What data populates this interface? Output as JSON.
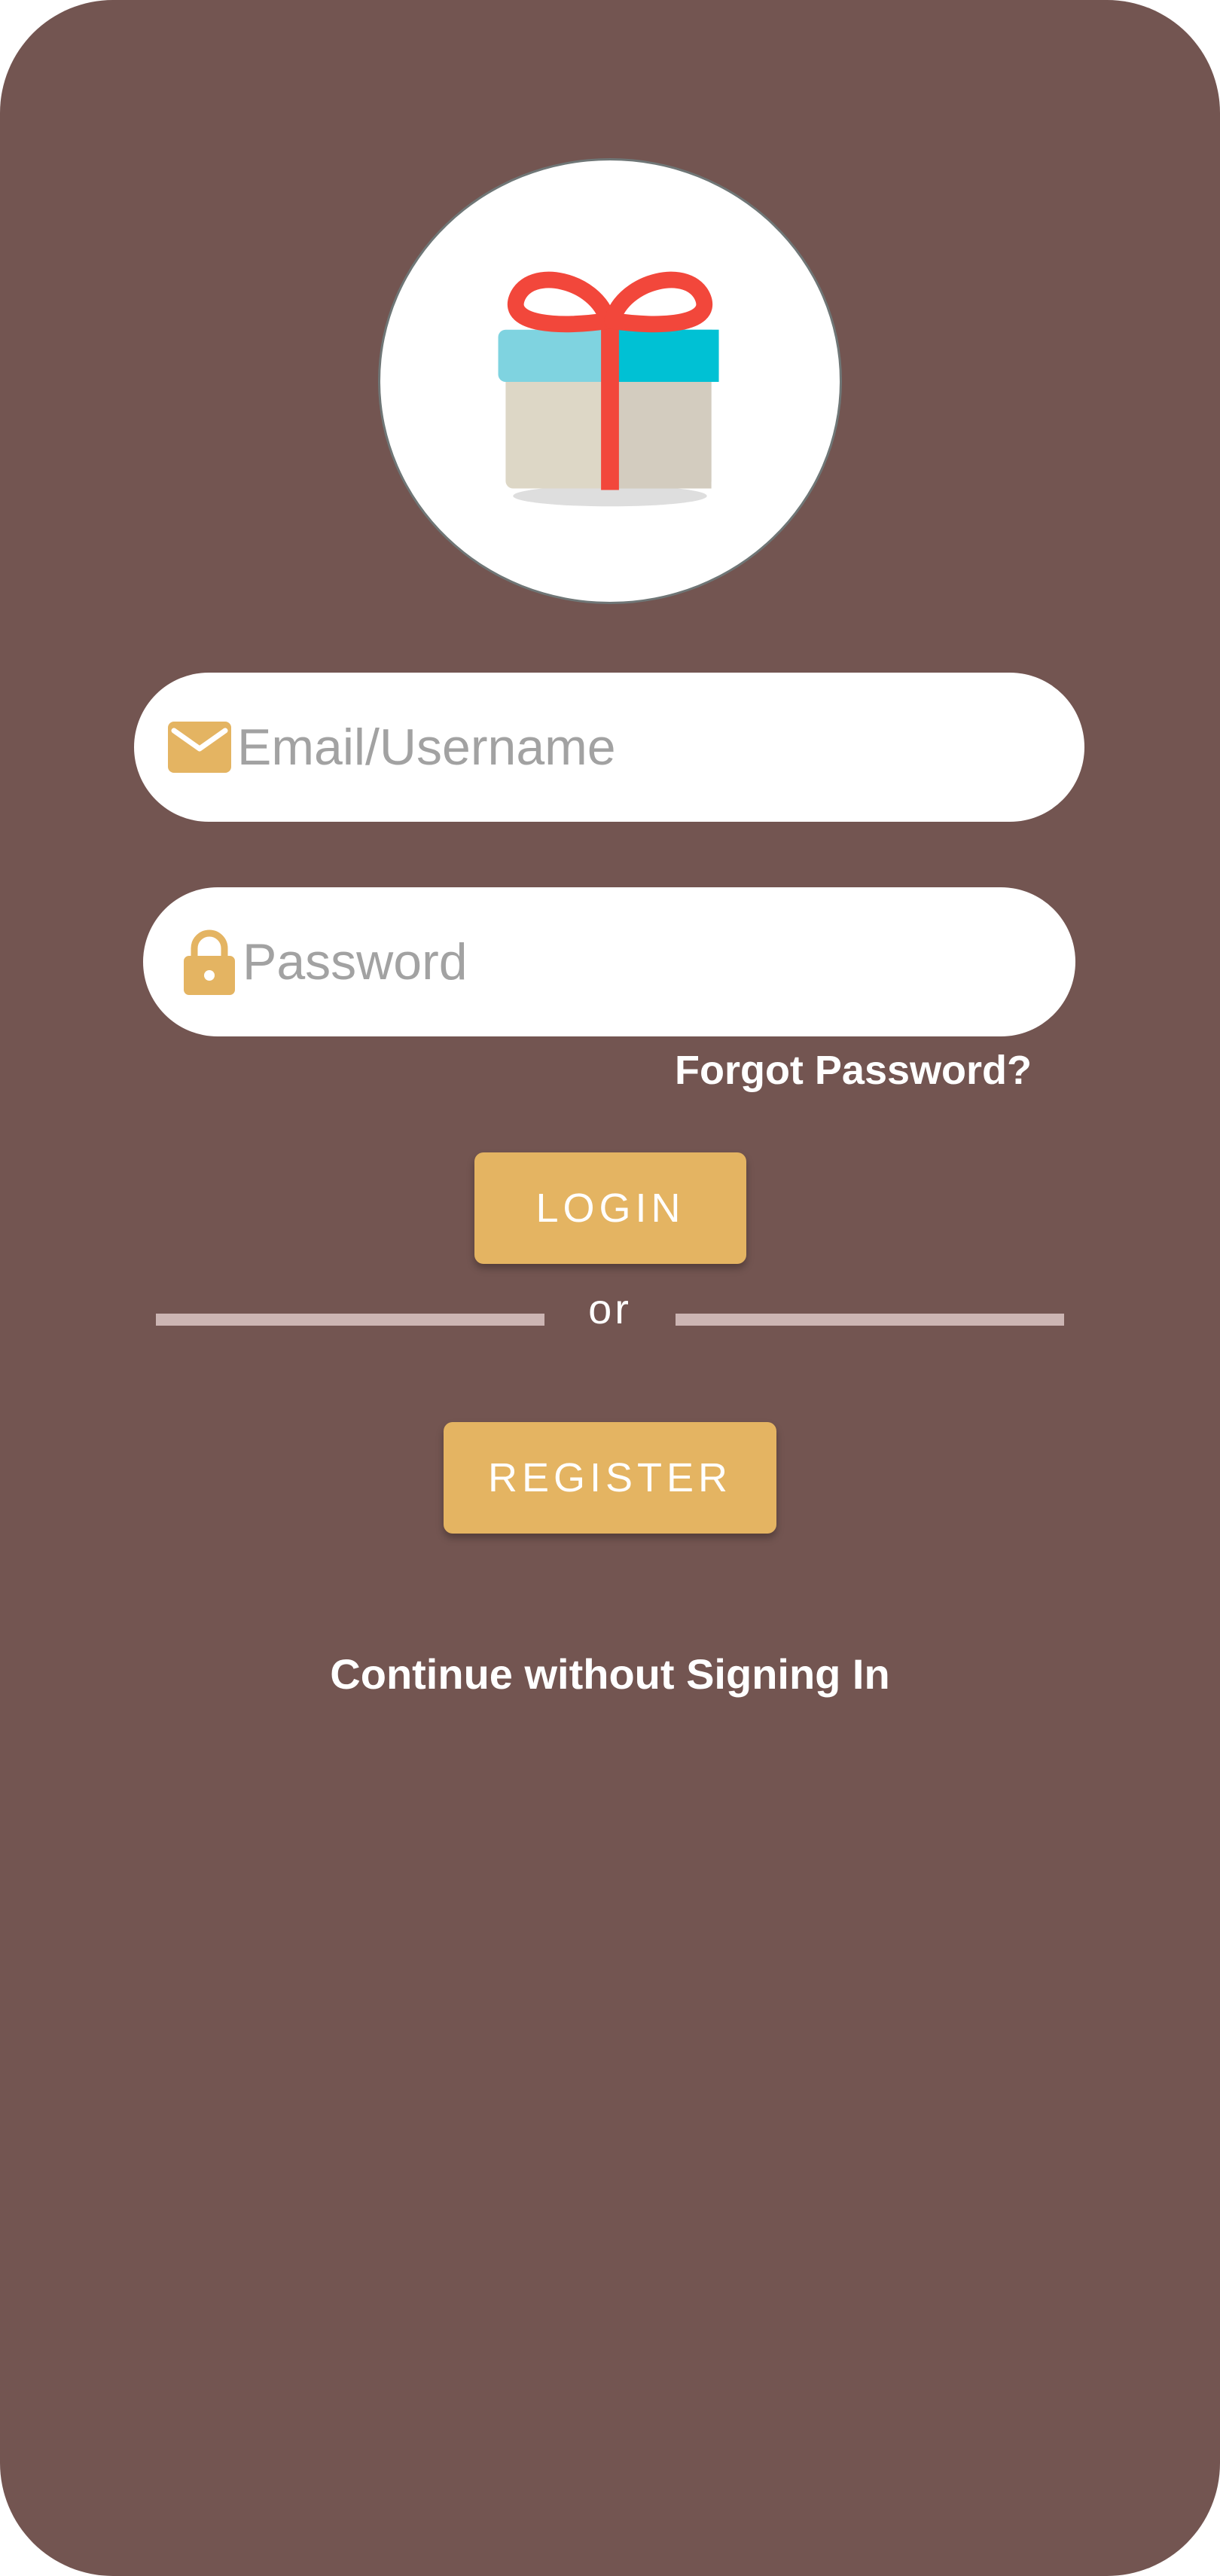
{
  "login": {
    "email": {
      "placeholder": "Email/Username",
      "value": "",
      "icon": "mail-icon"
    },
    "password": {
      "placeholder": "Password",
      "value": "",
      "icon": "lock-icon"
    },
    "forgot_password_label": "Forgot Password?",
    "login_label": "LOGIN",
    "or_label": "or",
    "register_label": "REGISTER",
    "continue_label": "Continue without Signing In"
  },
  "logo": {
    "icon": "gift-icon"
  },
  "colors": {
    "background": "#735551",
    "accent": "#e4b462",
    "divider": "#ccb5b3",
    "field_background": "#ffffff",
    "text_on_background": "#ffffff"
  }
}
